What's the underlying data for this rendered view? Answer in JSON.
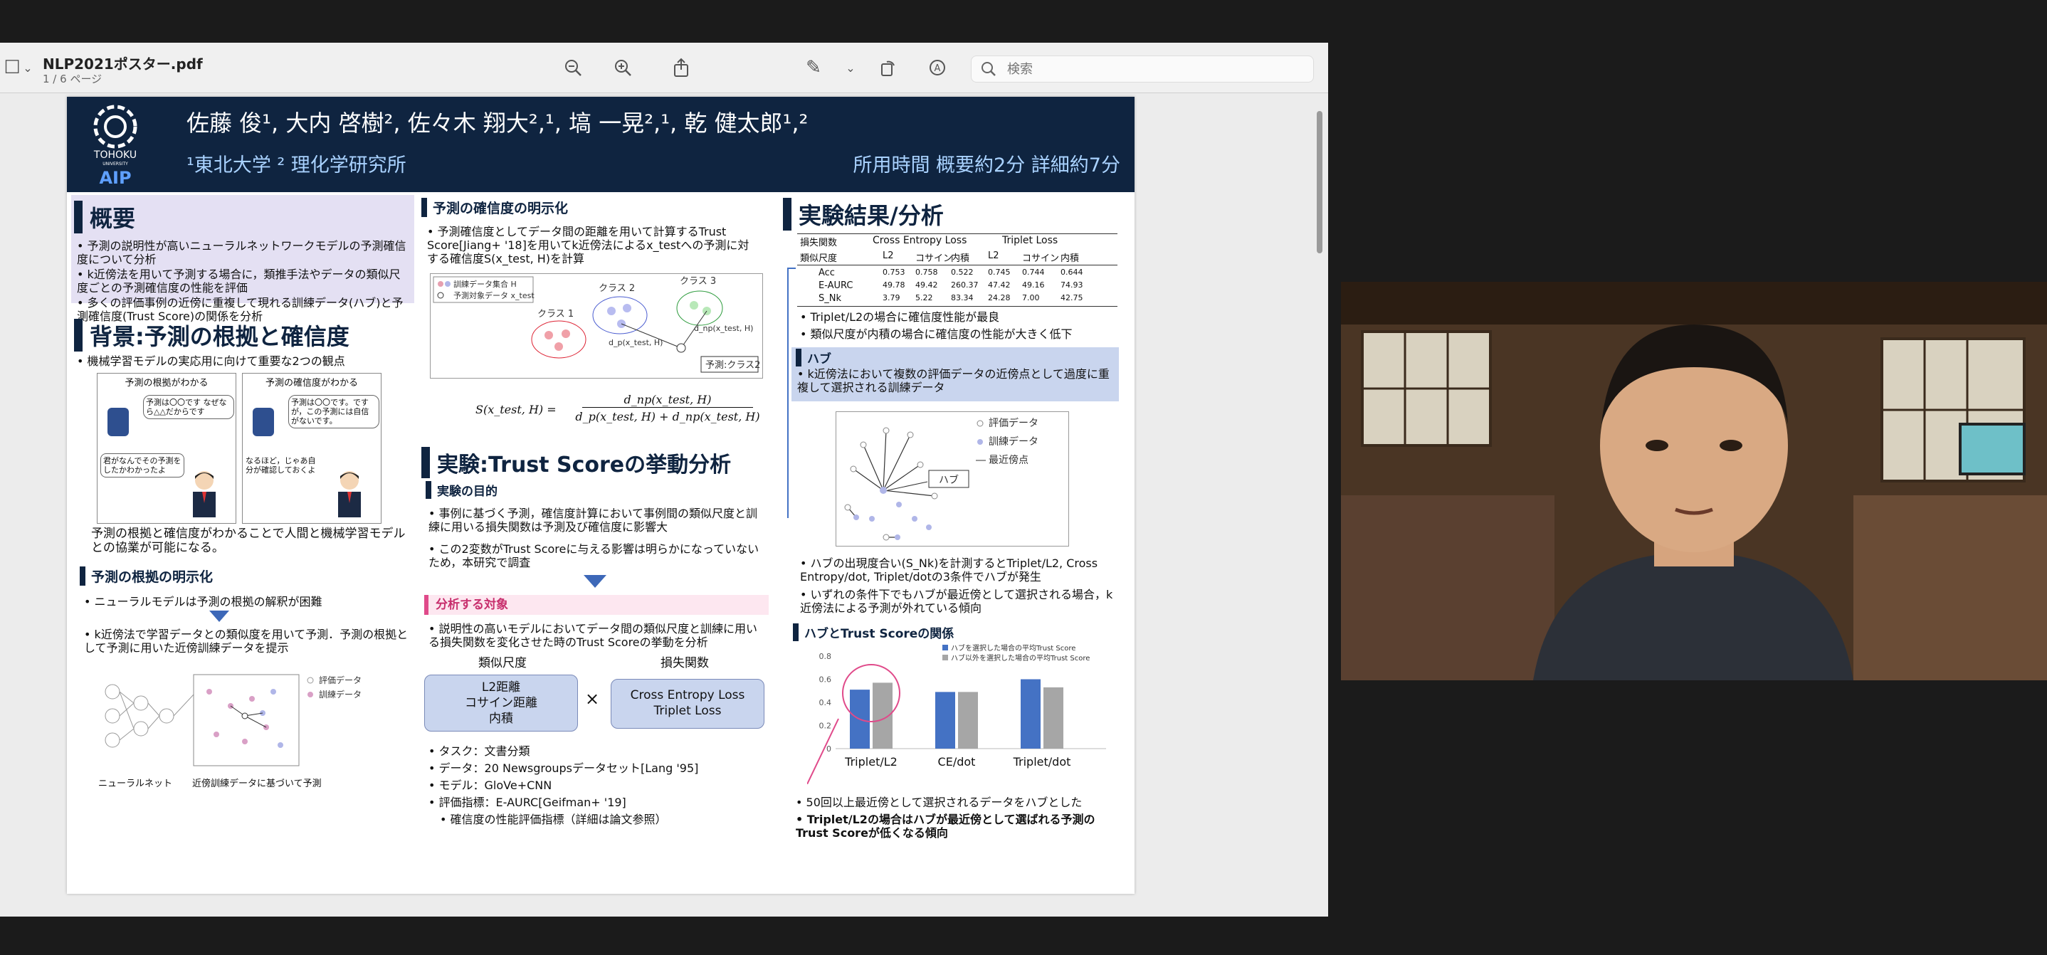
{
  "viewer": {
    "title": "NLP2021ポスター.pdf",
    "pages": "1 / 6 ページ",
    "search_placeholder": "検索"
  },
  "poster": {
    "authors": "佐藤 俊¹, 大内 啓樹², 佐々木 翔大²,¹, 塙 一晃²,¹, 乾 健太郎¹,²",
    "affiliations": "¹東北大学 ² 理化学研究所",
    "time": "所用時間 概要約2分 詳細約7分",
    "logo_text": "TOHOKU",
    "logo_sub": "UNIVERSITY",
    "aip": "AIP",
    "overview": {
      "title": "概要",
      "bullets": [
        "予測の説明性が高いニューラルネットワークモデルの予測確信度について分析",
        "k近傍法を用いて予測する場合に，類推手法やデータの類似尺度ごとの予測確信度の性能を評価",
        "多くの評価事例の近傍に重複して現れる訓練データ(ハブ)と予測確信度(Trust Score)の関係を分析"
      ]
    },
    "background": {
      "title": "背景:予測の根拠と確信度",
      "bullet": "機械学習モデルの実応用に向けて重要な2つの観点",
      "panel1_title": "予測の根拠がわかる",
      "panel2_title": "予測の確信度がわかる",
      "panel1_bubble": "予測は〇〇です なぜなら△△だからです",
      "panel2_bubble": "予測は〇〇です。ですが，この予測には自信がないです。",
      "panel1_reply": "君がなんでその予測をしたかわかったよ",
      "panel2_reply": "なるほど，じゃあ自分が確認しておくよ",
      "summary": "予測の根拠と確信度がわかることで人間と機械学習モデルとの協業が可能になる。"
    },
    "basis": {
      "title": "予測の根拠の明示化",
      "bullet1": "ニューラルモデルは予測の根拠の解釈が困難",
      "bullet2": "k近傍法で学習データとの類似度を用いて予測．予測の根拠として予測に用いた近傍訓練データを提示",
      "legend_eval": "評価データ",
      "legend_train": "訓練データ",
      "cap_nn": "ニューラルネット",
      "cap_knn": "近傍訓練データに基づいて予測"
    },
    "confidence": {
      "title": "予測の確信度の明示化",
      "bullet": "予測確信度としてデータ間の距離を用いて計算するTrust Score[Jiang+ '18]を用いてk近傍法によるx_testへの予測に対する確信度S(x_test, H)を計算",
      "legend_train": "訓練データ集合 H",
      "legend_test": "予測対象データ x_test",
      "class1": "クラス 1",
      "class2": "クラス 2",
      "class3": "クラス 3",
      "pred": "予測:クラス2",
      "d_p": "d_p(x_test, H)",
      "d_np": "d_np(x_test, H)",
      "formula_lhs": "S(x_test, H) =",
      "formula_num": "d_np(x_test, H)",
      "formula_den": "d_p(x_test, H) + d_np(x_test, H)"
    },
    "experiment": {
      "title": "実験:Trust Scoreの挙動分析",
      "purpose_title": "実験の目的",
      "purpose1": "事例に基づく予測，確信度計算において事例間の類似尺度と訓練に用いる損失関数は予測及び確信度に影響大",
      "purpose2": "この2変数がTrust Scoreに与える影響は明らかになっていないため，本研究で調査",
      "target_title": "分析する対象",
      "target_text": "説明性の高いモデルにおいてデータ間の類似尺度と訓練に用いる損失関数を変化させた時のTrust Scoreの挙動を分析",
      "sim_label": "類似尺度",
      "loss_label": "損失関数",
      "sim_box": [
        "L2距離",
        "コサイン距離",
        "内積"
      ],
      "loss_box": [
        "Cross Entropy Loss",
        "Triplet Loss"
      ],
      "times": "×",
      "settings": [
        "タスク：文書分類",
        "データ：20 Newsgroupsデータセット[Lang '95]",
        "モデル：GloVe+CNN",
        "評価指標：E-AURC[Geifman+ '19]",
        "確信度の性能評価指標（詳細は論文参照）"
      ]
    },
    "results": {
      "title": "実験結果/分析",
      "table": {
        "h_loss": "損失関数",
        "h_ce": "Cross Entropy Loss",
        "h_tl": "Triplet Loss",
        "h_sim": "類似尺度",
        "cols": [
          "L2",
          "コサイン",
          "内積",
          "L2",
          "コサイン",
          "内積"
        ],
        "rows": [
          {
            "name": "Acc",
            "vals": [
              "0.753",
              "0.758",
              "0.522",
              "0.745",
              "0.744",
              "0.644"
            ]
          },
          {
            "name": "E-AURC",
            "vals": [
              "49.78",
              "49.42",
              "260.37",
              "47.42",
              "49.16",
              "74.93"
            ]
          },
          {
            "name": "S_Nk",
            "vals": [
              "3.79",
              "5.22",
              "83.34",
              "24.28",
              "7.00",
              "42.75"
            ]
          }
        ]
      },
      "finding1": "Triplet/L2の場合に確信度性能が最良",
      "finding2": "類似尺度が内積の場合に確信度の性能が大きく低下",
      "hub_title": "ハブ",
      "hub_text": "k近傍法において複数の評価データの近傍点として過度に重複して選択される訓練データ",
      "hub_legend": [
        "評価データ",
        "訓練データ",
        "最近傍点"
      ],
      "hub_label": "ハブ",
      "hub_finding1": "ハブの出現度合い(S_Nk)を計測するとTriplet/L2, Cross Entropy/dot, Triplet/dotの3条件でハブが発生",
      "hub_finding2": "いずれの条件下でもハブが最近傍として選択される場合，k近傍法による予測が外れている傾向",
      "rel_title": "ハブとTrust Scoreの関係",
      "note1": "50回以上最近傍として選択されるデータをハブとした",
      "note2": "Triplet/L2の場合はハブが最近傍として選ばれる予測のTrust Scoreが低くなる傾向"
    }
  },
  "chart_data": {
    "type": "bar",
    "categories": [
      "Triplet/L2",
      "CE/dot",
      "Triplet/dot"
    ],
    "series": [
      {
        "name": "ハブを選択した場合の平均Trust Score",
        "values": [
          0.51,
          0.49,
          0.6
        ],
        "color": "#4472c4"
      },
      {
        "name": "ハブ以外を選択した場合の平均Trust Score",
        "values": [
          0.57,
          0.49,
          0.53
        ],
        "color": "#a6a6a6"
      }
    ],
    "ylim": [
      0,
      0.8
    ],
    "yticks": [
      "0",
      "0.2",
      "0.4",
      "0.6",
      "0.8"
    ],
    "legend": "top-right"
  },
  "colors": {
    "header": "#0f2440",
    "accent": "#4472c4",
    "highlight": "#e04a8a"
  }
}
